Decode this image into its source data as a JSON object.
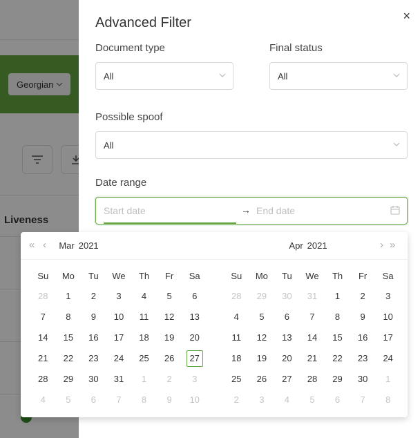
{
  "background": {
    "language_label": "Georgian",
    "column_header": "Liveness"
  },
  "drawer": {
    "title": "Advanced Filter",
    "close_symbol": "×",
    "document_type": {
      "label": "Document type",
      "value": "All"
    },
    "final_status": {
      "label": "Final status",
      "value": "All"
    },
    "possible_spoof": {
      "label": "Possible spoof",
      "value": "All"
    },
    "date_range": {
      "label": "Date range",
      "start_placeholder": "Start date",
      "end_placeholder": "End date",
      "separator": "→"
    }
  },
  "picker": {
    "left": {
      "month": "Mar",
      "year": "2021",
      "weekdays": [
        "Su",
        "Mo",
        "Tu",
        "We",
        "Th",
        "Fr",
        "Sa"
      ],
      "weeks": [
        [
          {
            "d": "28",
            "o": true
          },
          {
            "d": "1"
          },
          {
            "d": "2"
          },
          {
            "d": "3"
          },
          {
            "d": "4"
          },
          {
            "d": "5"
          },
          {
            "d": "6"
          }
        ],
        [
          {
            "d": "7"
          },
          {
            "d": "8"
          },
          {
            "d": "9"
          },
          {
            "d": "10"
          },
          {
            "d": "11"
          },
          {
            "d": "12"
          },
          {
            "d": "13"
          }
        ],
        [
          {
            "d": "14"
          },
          {
            "d": "15"
          },
          {
            "d": "16"
          },
          {
            "d": "17"
          },
          {
            "d": "18"
          },
          {
            "d": "19"
          },
          {
            "d": "20"
          }
        ],
        [
          {
            "d": "21"
          },
          {
            "d": "22"
          },
          {
            "d": "23"
          },
          {
            "d": "24"
          },
          {
            "d": "25"
          },
          {
            "d": "26"
          },
          {
            "d": "27",
            "t": true
          }
        ],
        [
          {
            "d": "28"
          },
          {
            "d": "29"
          },
          {
            "d": "30"
          },
          {
            "d": "31"
          },
          {
            "d": "1",
            "o": true
          },
          {
            "d": "2",
            "o": true
          },
          {
            "d": "3",
            "o": true
          }
        ],
        [
          {
            "d": "4",
            "o": true
          },
          {
            "d": "5",
            "o": true
          },
          {
            "d": "6",
            "o": true
          },
          {
            "d": "7",
            "o": true
          },
          {
            "d": "8",
            "o": true
          },
          {
            "d": "9",
            "o": true
          },
          {
            "d": "10",
            "o": true
          }
        ]
      ]
    },
    "right": {
      "month": "Apr",
      "year": "2021",
      "weekdays": [
        "Su",
        "Mo",
        "Tu",
        "We",
        "Th",
        "Fr",
        "Sa"
      ],
      "weeks": [
        [
          {
            "d": "28",
            "o": true
          },
          {
            "d": "29",
            "o": true
          },
          {
            "d": "30",
            "o": true
          },
          {
            "d": "31",
            "o": true
          },
          {
            "d": "1"
          },
          {
            "d": "2"
          },
          {
            "d": "3"
          }
        ],
        [
          {
            "d": "4"
          },
          {
            "d": "5"
          },
          {
            "d": "6"
          },
          {
            "d": "7"
          },
          {
            "d": "8"
          },
          {
            "d": "9"
          },
          {
            "d": "10"
          }
        ],
        [
          {
            "d": "11"
          },
          {
            "d": "12"
          },
          {
            "d": "13"
          },
          {
            "d": "14"
          },
          {
            "d": "15"
          },
          {
            "d": "16"
          },
          {
            "d": "17"
          }
        ],
        [
          {
            "d": "18"
          },
          {
            "d": "19"
          },
          {
            "d": "20"
          },
          {
            "d": "21"
          },
          {
            "d": "22"
          },
          {
            "d": "23"
          },
          {
            "d": "24"
          }
        ],
        [
          {
            "d": "25"
          },
          {
            "d": "26"
          },
          {
            "d": "27"
          },
          {
            "d": "28"
          },
          {
            "d": "29"
          },
          {
            "d": "30"
          },
          {
            "d": "1",
            "o": true
          }
        ],
        [
          {
            "d": "2",
            "o": true
          },
          {
            "d": "3",
            "o": true
          },
          {
            "d": "4",
            "o": true
          },
          {
            "d": "5",
            "o": true
          },
          {
            "d": "6",
            "o": true
          },
          {
            "d": "7",
            "o": true
          },
          {
            "d": "8",
            "o": true
          }
        ]
      ]
    },
    "nav": {
      "super_prev": "«",
      "prev": "‹",
      "next": "›",
      "super_next": "»"
    }
  },
  "colors": {
    "accent": "#63a63f",
    "overlay": "rgba(0,0,0,0.45)"
  }
}
